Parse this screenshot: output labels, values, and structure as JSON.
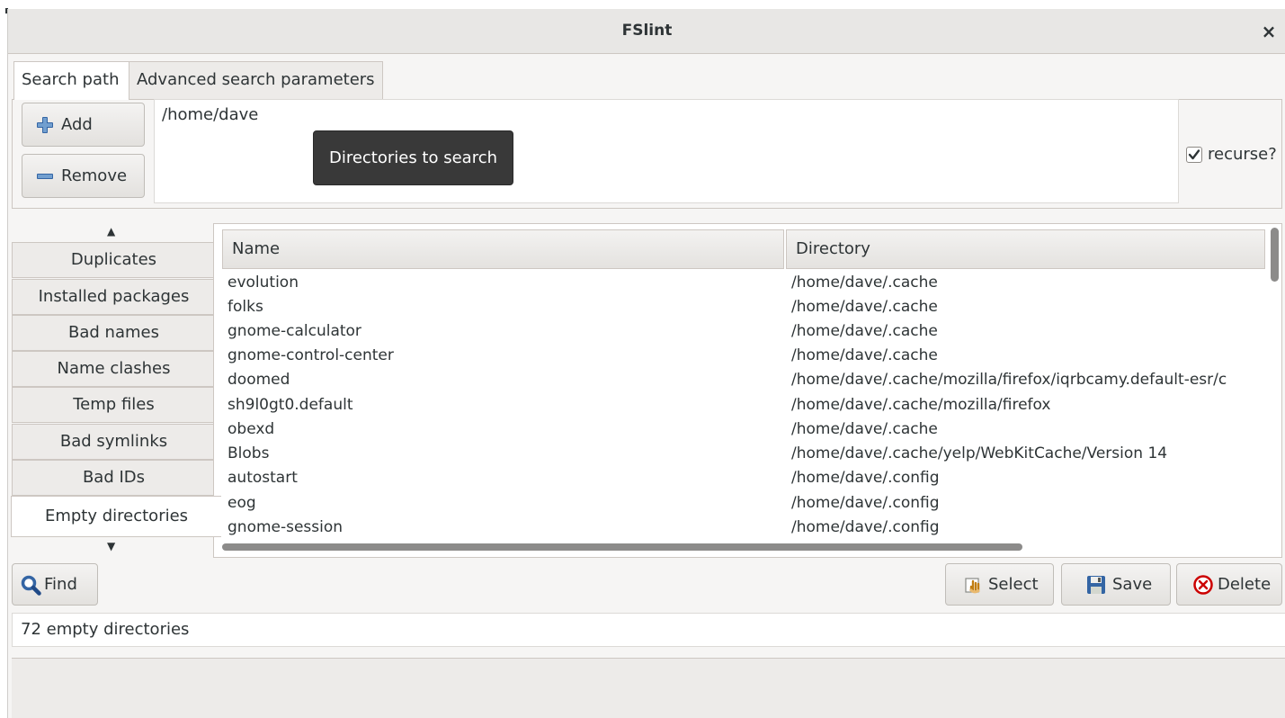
{
  "window": {
    "title": "FSlint",
    "close_glyph": "×"
  },
  "tabs": [
    {
      "label": "Search path",
      "active": true
    },
    {
      "label": "Advanced search parameters",
      "active": false
    }
  ],
  "search": {
    "add_label": "Add",
    "remove_label": "Remove",
    "paths": [
      "/home/dave"
    ],
    "tooltip": "Directories to search",
    "recurse_label": "recurse?",
    "recurse_checked": true
  },
  "categories": {
    "up_arrow": "▲",
    "down_arrow": "▼",
    "items": [
      {
        "label": "Duplicates"
      },
      {
        "label": "Installed packages"
      },
      {
        "label": "Bad names"
      },
      {
        "label": "Name clashes"
      },
      {
        "label": "Temp files"
      },
      {
        "label": "Bad symlinks"
      },
      {
        "label": "Bad IDs"
      },
      {
        "label": "Empty directories"
      }
    ],
    "active": "Empty directories"
  },
  "results": {
    "columns": [
      "Name",
      "Directory"
    ],
    "rows": [
      {
        "name": "evolution",
        "directory": "/home/dave/.cache"
      },
      {
        "name": "folks",
        "directory": "/home/dave/.cache"
      },
      {
        "name": "gnome-calculator",
        "directory": "/home/dave/.cache"
      },
      {
        "name": "gnome-control-center",
        "directory": "/home/dave/.cache"
      },
      {
        "name": "doomed",
        "directory": "/home/dave/.cache/mozilla/firefox/iqrbcamy.default-esr/c"
      },
      {
        "name": "sh9l0gt0.default",
        "directory": "/home/dave/.cache/mozilla/firefox"
      },
      {
        "name": "obexd",
        "directory": "/home/dave/.cache"
      },
      {
        "name": "Blobs",
        "directory": "/home/dave/.cache/yelp/WebKitCache/Version 14"
      },
      {
        "name": "autostart",
        "directory": "/home/dave/.config"
      },
      {
        "name": "eog",
        "directory": "/home/dave/.config"
      },
      {
        "name": "gnome-session",
        "directory": "/home/dave/.config"
      }
    ]
  },
  "actions": {
    "find_label": "Find",
    "select_label": "Select",
    "save_label": "Save",
    "delete_label": "Delete"
  },
  "status": {
    "text": "72 empty directories"
  },
  "icons": {
    "add": "plus-icon",
    "remove": "minus-icon",
    "find": "magnifier-icon",
    "select": "select-hand-icon",
    "save": "save-disk-icon",
    "delete": "delete-circle-icon",
    "check": "checkmark-icon"
  },
  "colors": {
    "add_icon": "#3465a4",
    "find_icon": "#3465a4",
    "delete_icon": "#cc0000",
    "tooltip_bg": "#393939"
  }
}
